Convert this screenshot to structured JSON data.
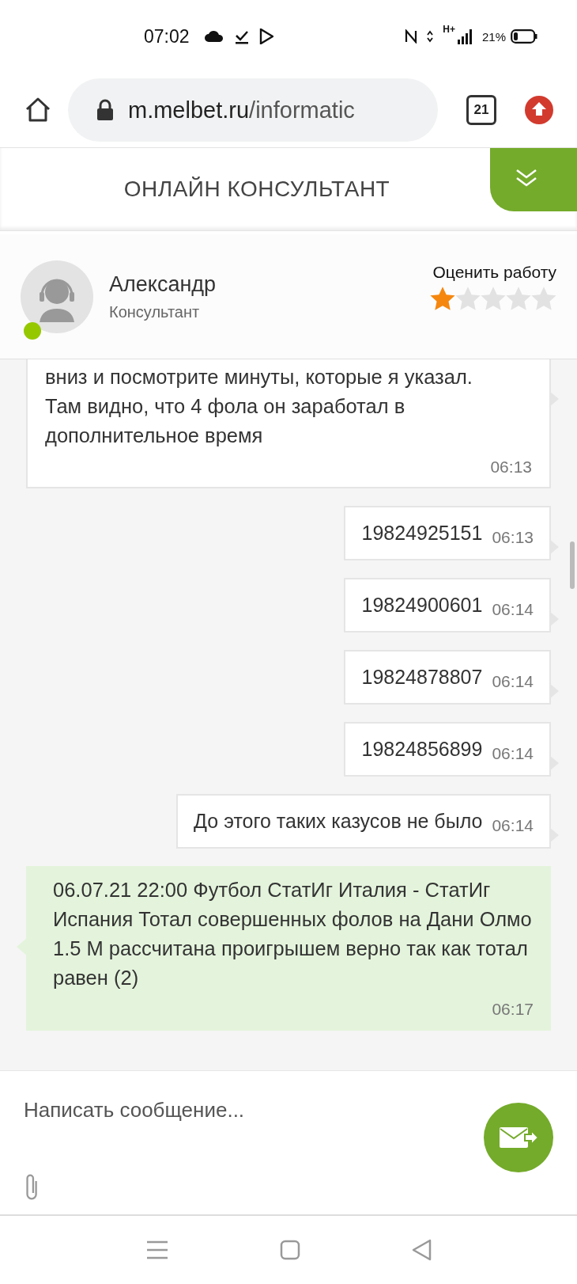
{
  "status_bar": {
    "time": "07:02",
    "network": "H+",
    "battery": "21%"
  },
  "browser": {
    "url_host": "m.melbet.ru",
    "url_path": "/informatic",
    "tab_count": "21"
  },
  "header": {
    "title": "ОНЛАЙН КОНСУЛЬТАНТ"
  },
  "agent": {
    "name": "Александр",
    "role": "Консультант",
    "online": true,
    "rating_label": "Оценить работу",
    "stars": 1
  },
  "messages": [
    {
      "kind": "wide",
      "text": "вниз и посмотрите минуты, которые я указал. Там видно, что 4 фола он заработал в дополнительное время",
      "time": "06:13"
    },
    {
      "kind": "user",
      "text": "19824925151",
      "time": "06:13"
    },
    {
      "kind": "user",
      "text": "19824900601",
      "time": "06:14"
    },
    {
      "kind": "user",
      "text": "19824878807",
      "time": "06:14"
    },
    {
      "kind": "user",
      "text": "19824856899",
      "time": "06:14"
    },
    {
      "kind": "user",
      "text": "До этого таких казусов не было",
      "time": "06:14"
    },
    {
      "kind": "operator",
      "text": "06.07.21 22:00 Футбол СтатИг Италия - СтатИг Испания  Тотал совершенных фолов на Дани Олмо 1.5 М рассчитана проигрышем верно так как тотал равен (2)",
      "time": "06:17"
    }
  ],
  "composer": {
    "placeholder": "Написать сообщение..."
  }
}
